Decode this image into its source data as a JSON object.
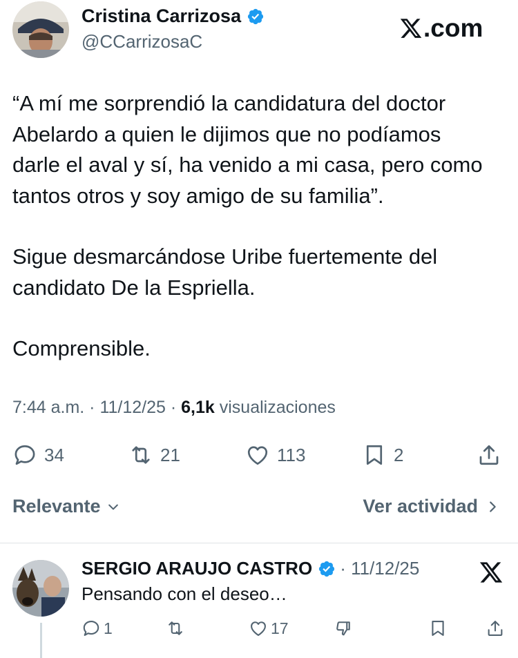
{
  "source_badge": {
    "text": ".com",
    "icon": "x-logo-icon"
  },
  "author": {
    "name": "Cristina Carrizosa",
    "handle": "@CCarrizosaC",
    "verified_icon": "verified-badge-icon",
    "verified_color": "#1d9bf0"
  },
  "post": {
    "paragraphs": [
      "“A mí me sorprendió la candidatura del doctor",
      "Abelardo a quien le dijimos que no podíamos",
      "darle el aval y sí, ha venido a mi casa, pero como",
      "tantos otros y soy amigo de su familia”.",
      "Sigue desmarcándose Uribe fuertemente del",
      "candidato De la Espriella.",
      "Comprensible."
    ],
    "time": "7:44 a.m. · 11/12/25 · ",
    "views_count": "6,1k",
    "views_label": " visualizaciones"
  },
  "actions": {
    "replies": "34",
    "reposts": "21",
    "likes": "113",
    "bookmarks": "2"
  },
  "sort": {
    "label": "Relevante",
    "activity": "Ver actividad"
  },
  "reply": {
    "name": "SERGIO ARAUJO CASTRO",
    "date": "· 11/12/25",
    "text": "Pensando con el deseo…",
    "replies": "1",
    "reposts": "",
    "likes": "17"
  },
  "colors": {
    "text": "#0f1419",
    "secondary": "#536471",
    "accent": "#1d9bf0"
  }
}
